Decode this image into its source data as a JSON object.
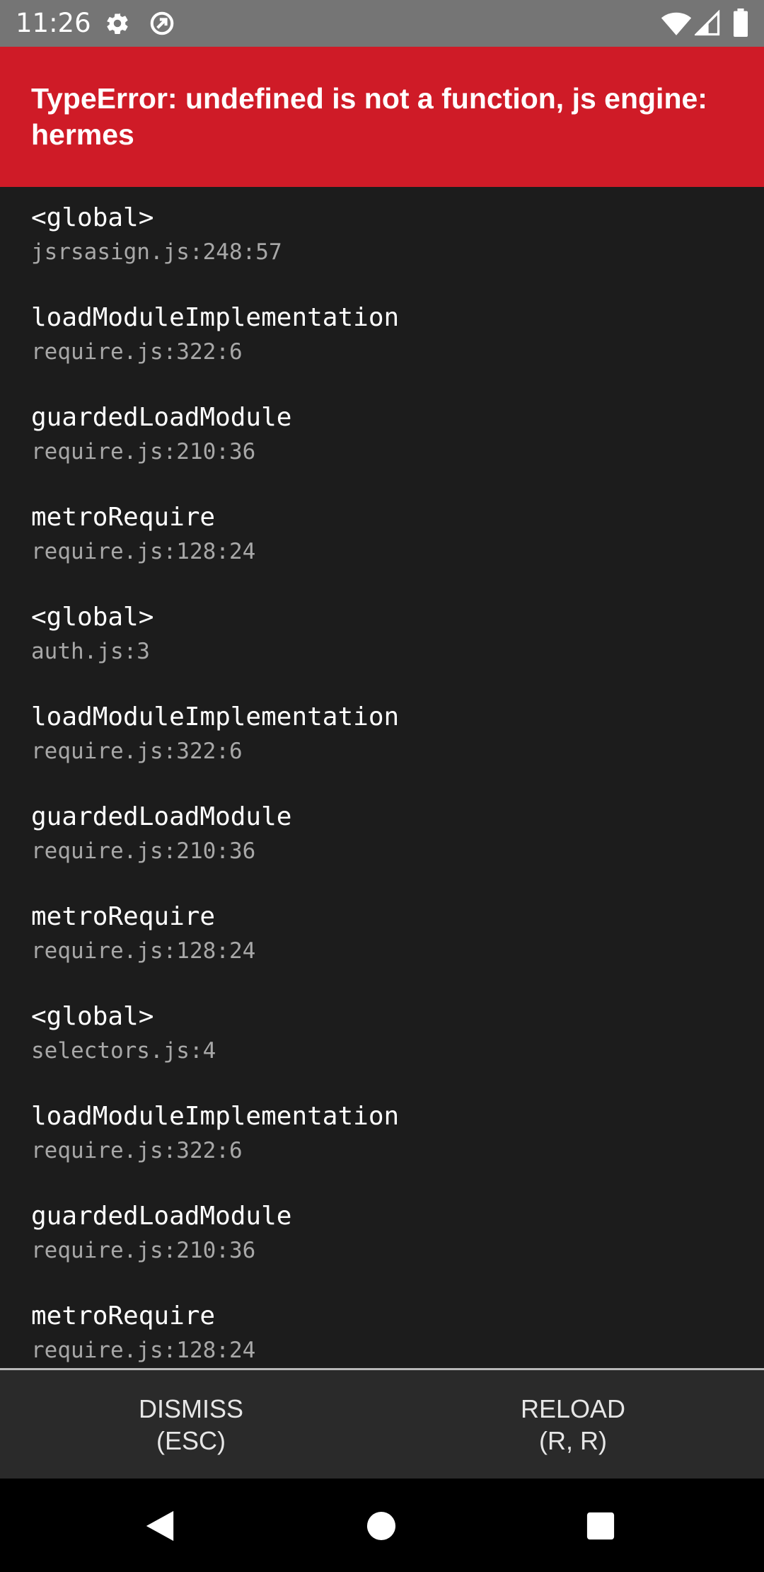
{
  "status_bar": {
    "time": "11:26",
    "icons": [
      "gear-icon",
      "sync-off-icon",
      "wifi-icon",
      "signal-icon",
      "battery-icon"
    ]
  },
  "error": {
    "title": "TypeError: undefined is not a function, js engine: hermes"
  },
  "stack_frames": [
    {
      "name": "<global>",
      "location": "jsrsasign.js:248:57"
    },
    {
      "name": "loadModuleImplementation",
      "location": "require.js:322:6"
    },
    {
      "name": "guardedLoadModule",
      "location": "require.js:210:36"
    },
    {
      "name": "metroRequire",
      "location": "require.js:128:24"
    },
    {
      "name": "<global>",
      "location": "auth.js:3"
    },
    {
      "name": "loadModuleImplementation",
      "location": "require.js:322:6"
    },
    {
      "name": "guardedLoadModule",
      "location": "require.js:210:36"
    },
    {
      "name": "metroRequire",
      "location": "require.js:128:24"
    },
    {
      "name": "<global>",
      "location": "selectors.js:4"
    },
    {
      "name": "loadModuleImplementation",
      "location": "require.js:322:6"
    },
    {
      "name": "guardedLoadModule",
      "location": "require.js:210:36"
    },
    {
      "name": "metroRequire",
      "location": "require.js:128:24"
    }
  ],
  "footer": {
    "dismiss_line1": "DISMISS",
    "dismiss_line2": "(ESC)",
    "reload_line1": "RELOAD",
    "reload_line2": "(R, R)"
  },
  "colors": {
    "error_red": "#cf1b27",
    "background": "#1c1c1c",
    "status_bar": "#757575"
  }
}
